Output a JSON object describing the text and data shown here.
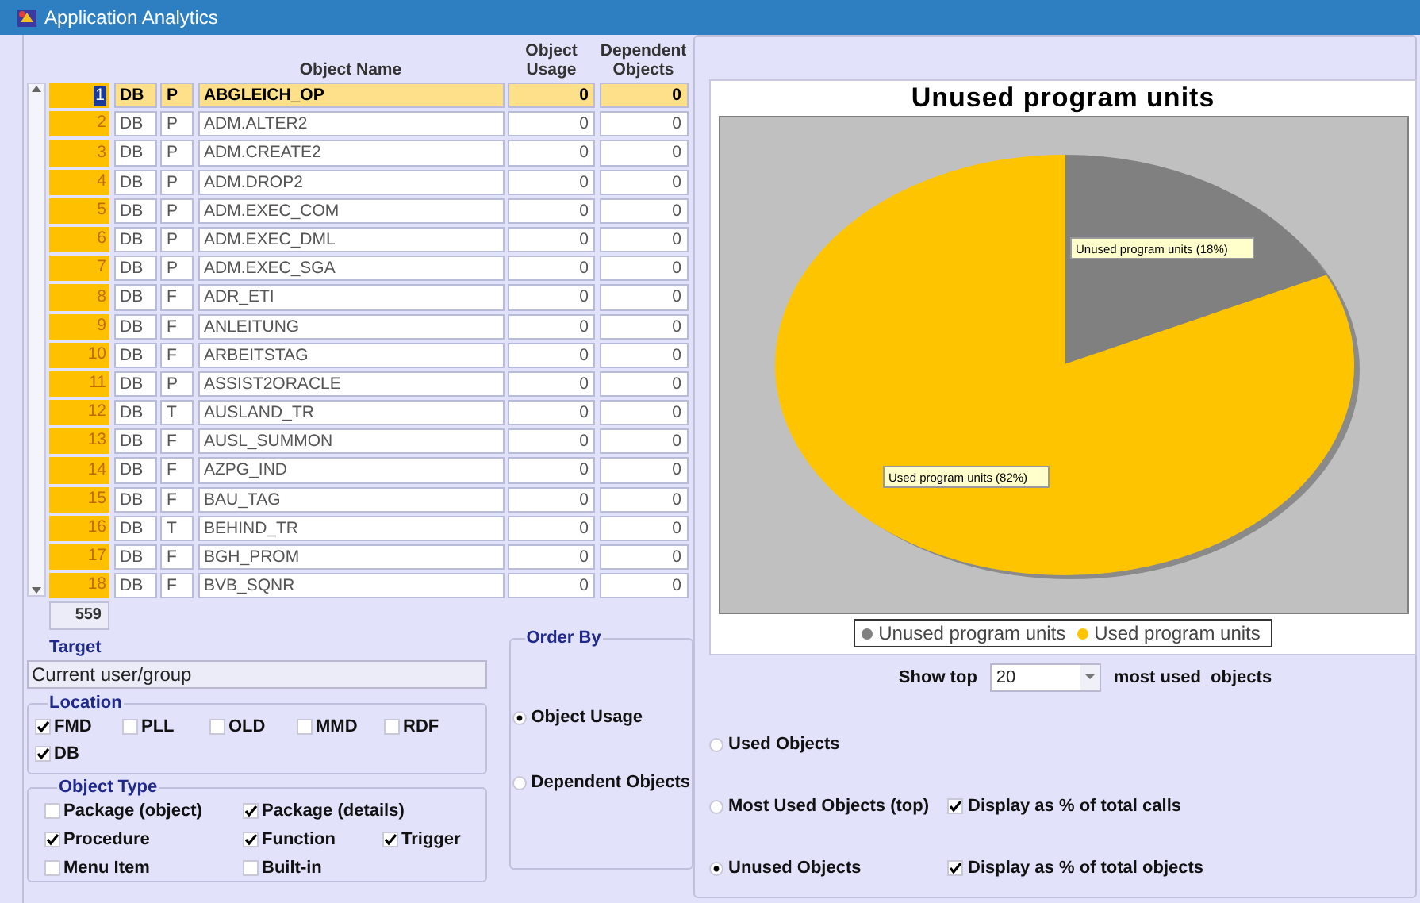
{
  "window": {
    "title": "Application Analytics"
  },
  "table": {
    "columns": [
      "Object Name",
      "Object Usage",
      "Dependent Objects"
    ],
    "rows": [
      {
        "number": "1",
        "location": "DB",
        "type": "P",
        "name": "ABGLEICH_OP",
        "usage": "0",
        "dependents": "0",
        "selected": true
      },
      {
        "number": "2",
        "location": "DB",
        "type": "P",
        "name": "ADM.ALTER2",
        "usage": "0",
        "dependents": "0",
        "selected": false
      },
      {
        "number": "3",
        "location": "DB",
        "type": "P",
        "name": "ADM.CREATE2",
        "usage": "0",
        "dependents": "0",
        "selected": false
      },
      {
        "number": "4",
        "location": "DB",
        "type": "P",
        "name": "ADM.DROP2",
        "usage": "0",
        "dependents": "0",
        "selected": false
      },
      {
        "number": "5",
        "location": "DB",
        "type": "P",
        "name": "ADM.EXEC_COM",
        "usage": "0",
        "dependents": "0",
        "selected": false
      },
      {
        "number": "6",
        "location": "DB",
        "type": "P",
        "name": "ADM.EXEC_DML",
        "usage": "0",
        "dependents": "0",
        "selected": false
      },
      {
        "number": "7",
        "location": "DB",
        "type": "P",
        "name": "ADM.EXEC_SGA",
        "usage": "0",
        "dependents": "0",
        "selected": false
      },
      {
        "number": "8",
        "location": "DB",
        "type": "F",
        "name": "ADR_ETI",
        "usage": "0",
        "dependents": "0",
        "selected": false
      },
      {
        "number": "9",
        "location": "DB",
        "type": "F",
        "name": "ANLEITUNG",
        "usage": "0",
        "dependents": "0",
        "selected": false
      },
      {
        "number": "10",
        "location": "DB",
        "type": "F",
        "name": "ARBEITSTAG",
        "usage": "0",
        "dependents": "0",
        "selected": false
      },
      {
        "number": "11",
        "location": "DB",
        "type": "P",
        "name": "ASSIST2ORACLE",
        "usage": "0",
        "dependents": "0",
        "selected": false
      },
      {
        "number": "12",
        "location": "DB",
        "type": "T",
        "name": "AUSLAND_TR",
        "usage": "0",
        "dependents": "0",
        "selected": false
      },
      {
        "number": "13",
        "location": "DB",
        "type": "F",
        "name": "AUSL_SUMMON",
        "usage": "0",
        "dependents": "0",
        "selected": false
      },
      {
        "number": "14",
        "location": "DB",
        "type": "F",
        "name": "AZPG_IND",
        "usage": "0",
        "dependents": "0",
        "selected": false
      },
      {
        "number": "15",
        "location": "DB",
        "type": "F",
        "name": "BAU_TAG",
        "usage": "0",
        "dependents": "0",
        "selected": false
      },
      {
        "number": "16",
        "location": "DB",
        "type": "T",
        "name": "BEHIND_TR",
        "usage": "0",
        "dependents": "0",
        "selected": false
      },
      {
        "number": "17",
        "location": "DB",
        "type": "F",
        "name": "BGH_PROM",
        "usage": "0",
        "dependents": "0",
        "selected": false
      },
      {
        "number": "18",
        "location": "DB",
        "type": "F",
        "name": "BVB_SQNR",
        "usage": "0",
        "dependents": "0",
        "selected": false
      }
    ],
    "count": "559"
  },
  "target": {
    "label": "Target",
    "value": "Current user/group"
  },
  "location": {
    "label": "Location",
    "options": [
      {
        "label": "FMD",
        "checked": true
      },
      {
        "label": "PLL",
        "checked": false
      },
      {
        "label": "OLD",
        "checked": false
      },
      {
        "label": "MMD",
        "checked": false
      },
      {
        "label": "RDF",
        "checked": false
      },
      {
        "label": "DB",
        "checked": true
      }
    ]
  },
  "object_type": {
    "label": "Object Type",
    "rows": [
      [
        {
          "label": "Package (object)",
          "checked": false
        },
        {
          "label": "Package (details)",
          "checked": true
        }
      ],
      [
        {
          "label": "Procedure",
          "checked": true
        },
        {
          "label": "Function",
          "checked": true
        },
        {
          "label": "Trigger",
          "checked": true
        }
      ],
      [
        {
          "label": "Menu Item",
          "checked": false
        },
        {
          "label": "Built-in",
          "checked": false
        }
      ]
    ]
  },
  "order_by": {
    "label": "Order By",
    "options": [
      {
        "label": "Object Usage",
        "selected": true
      },
      {
        "label": "Dependent Objects",
        "selected": false
      }
    ]
  },
  "chart": {
    "chart_data": {
      "type": "pie",
      "title": "Unused program units",
      "categories": [
        "Unused program units",
        "Used program units"
      ],
      "series": [
        {
          "values": [
            18,
            82
          ]
        }
      ],
      "legend": "bottom",
      "colors": [
        "#808080",
        "#ffc400"
      ],
      "annotations": [
        {
          "text": "Unused program units  (18%)"
        },
        {
          "text": "Used program units (82%)"
        }
      ]
    }
  },
  "show_top": {
    "label": "Show top",
    "value": "20",
    "suffix": "most used  objects"
  },
  "report": {
    "options": [
      {
        "label": "Used Objects",
        "selected": false
      },
      {
        "label": "Most Used Objects (top)",
        "selected": false,
        "display": {
          "label": "Display as % of total calls",
          "checked": true
        }
      },
      {
        "label": "Unused Objects",
        "selected": true,
        "display": {
          "label": "Display as % of total objects",
          "checked": true
        }
      }
    ]
  }
}
